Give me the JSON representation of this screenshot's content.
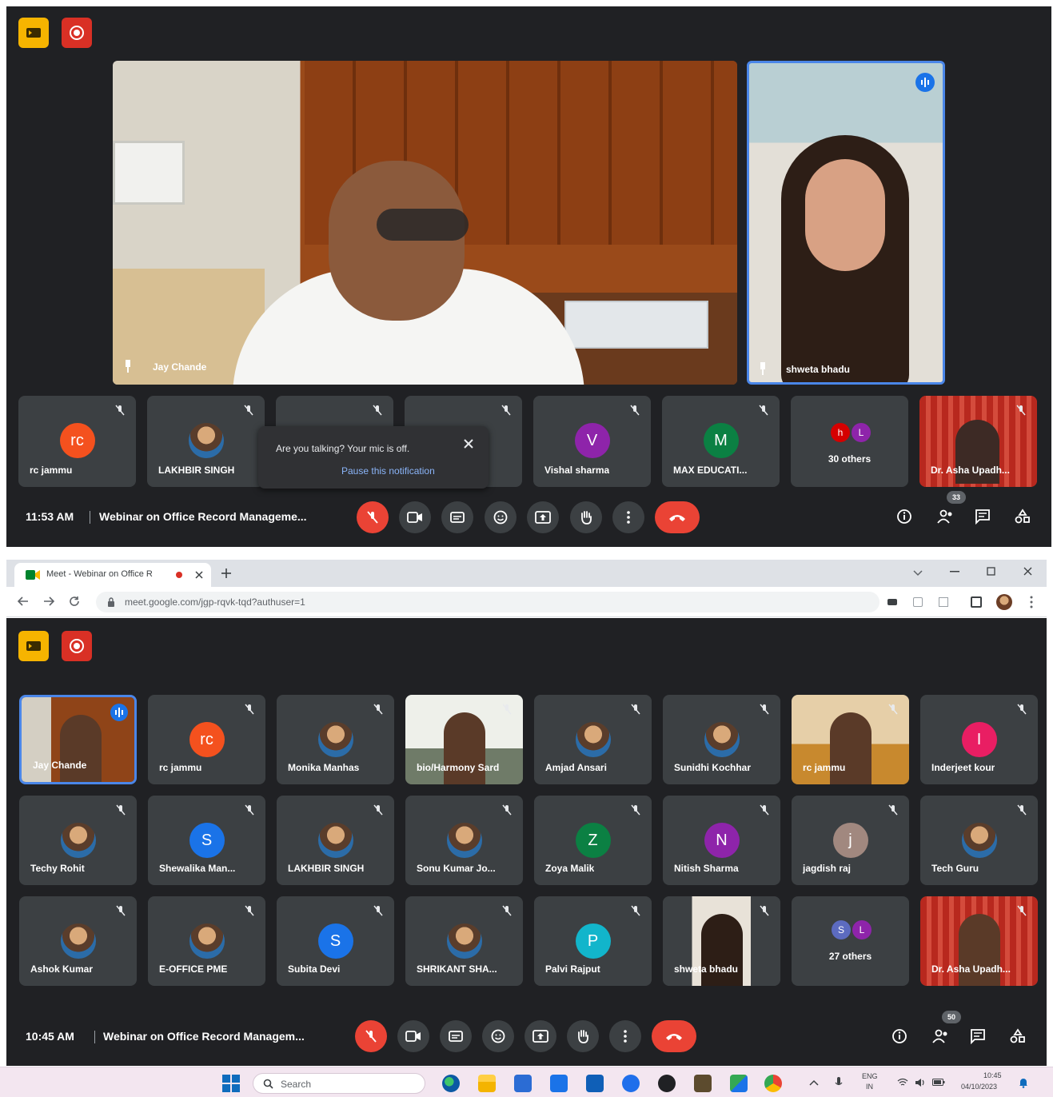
{
  "top": {
    "main_name": "Jay Chande",
    "side_name": "shweta bhadu",
    "strip": [
      "rc jammu",
      "LAKHBIR SINGH",
      "",
      "",
      "Vishal sharma",
      "MAX EDUCATI...",
      "30 others",
      "Dr. Asha Upadh..."
    ],
    "strip_avatars": [
      "rc",
      "",
      "",
      "",
      "V",
      "M",
      "",
      ""
    ],
    "others_avatars": [
      "h",
      "L"
    ],
    "notification": {
      "message": "Are you talking? Your mic is off.",
      "action": "Pause this notification"
    },
    "time": "11:53 AM",
    "meeting_title": "Webinar on Office Record Manageme...",
    "people_count": "33"
  },
  "browser": {
    "tab_title": "Meet - Webinar on Office R",
    "url": "meet.google.com/jgp-rqvk-tqd?authuser=1"
  },
  "bottom": {
    "grid": [
      {
        "name": "Jay Chande",
        "avatar": ""
      },
      {
        "name": "rc jammu",
        "avatar": "rc"
      },
      {
        "name": "Monika Manhas",
        "avatar": ""
      },
      {
        "name": "bio/Harmony Sard",
        "avatar": ""
      },
      {
        "name": "Amjad Ansari",
        "avatar": ""
      },
      {
        "name": "Sunidhi Kochhar",
        "avatar": ""
      },
      {
        "name": "rc jammu",
        "avatar": ""
      },
      {
        "name": "Inderjeet kour",
        "avatar": "I"
      },
      {
        "name": "Techy Rohit",
        "avatar": ""
      },
      {
        "name": "Shewalika Man...",
        "avatar": "S"
      },
      {
        "name": "LAKHBIR SINGH",
        "avatar": ""
      },
      {
        "name": "Sonu Kumar Jo...",
        "avatar": ""
      },
      {
        "name": "Zoya Malik",
        "avatar": "Z"
      },
      {
        "name": "Nitish Sharma",
        "avatar": "N"
      },
      {
        "name": "jagdish raj",
        "avatar": "j"
      },
      {
        "name": "Tech Guru",
        "avatar": ""
      },
      {
        "name": "Ashok Kumar",
        "avatar": ""
      },
      {
        "name": "E-OFFICE PME",
        "avatar": ""
      },
      {
        "name": "Subita Devi",
        "avatar": "S"
      },
      {
        "name": "SHRIKANT SHA...",
        "avatar": ""
      },
      {
        "name": "Palvi Rajput",
        "avatar": "P"
      },
      {
        "name": "shweta bhadu",
        "avatar": ""
      },
      {
        "name": "27 others",
        "avatar": ""
      },
      {
        "name": "Dr. Asha Upadh...",
        "avatar": ""
      }
    ],
    "others_avatars": [
      "S",
      "L"
    ],
    "time": "10:45 AM",
    "meeting_title": "Webinar on Office Record Managem...",
    "people_count": "50"
  },
  "taskbar": {
    "search": "Search",
    "lang": "ENG",
    "lang_sub": "IN",
    "clock_time": "10:45",
    "clock_date": "04/10/2023"
  },
  "colors": {
    "meet_bg": "#202124",
    "tile_bg": "#3c4043",
    "hangup": "#ea4335",
    "active_border": "#4a86e8"
  }
}
